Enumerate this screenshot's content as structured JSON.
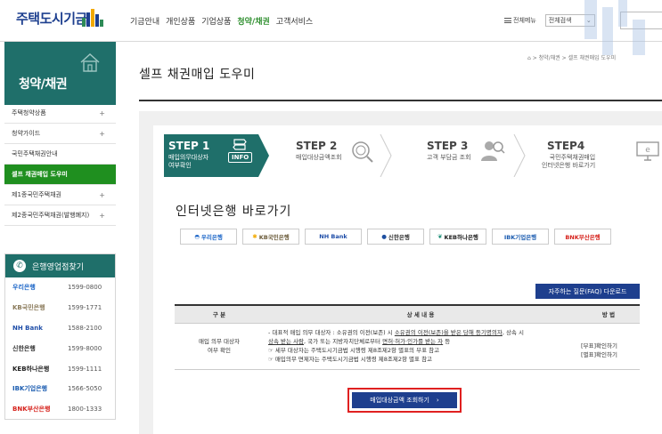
{
  "brand": {
    "name": "주택도시기금"
  },
  "gnb": [
    {
      "label": "기금안내",
      "active": false
    },
    {
      "label": "개인상품",
      "active": false
    },
    {
      "label": "기업상품",
      "active": false
    },
    {
      "label": "청약/채권",
      "active": true
    },
    {
      "label": "고객서비스",
      "active": false
    }
  ],
  "util": {
    "all_menu": "전체메뉴",
    "search_scope": "전체검색"
  },
  "lnb": {
    "title": "청약/채권",
    "items": [
      {
        "label": "주택청약상품",
        "plus": "+"
      },
      {
        "label": "청약가이드",
        "plus": "+"
      },
      {
        "label": "국민주택채권안내",
        "plus": ""
      },
      {
        "label": "셀프 채권매입 도우미",
        "plus": "",
        "active": true
      },
      {
        "label": "제1종국민주택채권",
        "plus": "+"
      },
      {
        "label": "제2종국민주택채권(발행폐지)",
        "plus": "+"
      }
    ]
  },
  "bankbox": {
    "title": "은행영업점찾기",
    "banks": [
      {
        "name": "우리은행",
        "tel": "1599-0800",
        "color": "#1e67c8"
      },
      {
        "name": "KB국민은행",
        "tel": "1599-1771",
        "color": "#f2a900"
      },
      {
        "name": "NH Bank",
        "tel": "1588-2100",
        "color": "#1f4ea8"
      },
      {
        "name": "신한은행",
        "tel": "1599-8000",
        "color": "#1e4fa0"
      },
      {
        "name": "KEB하나은행",
        "tel": "1599-1111",
        "color": "#138a72"
      },
      {
        "name": "IBK기업은행",
        "tel": "1566-5050",
        "color": "#1b5cb0"
      },
      {
        "name": "BNK부산은행",
        "tel": "1800-1333",
        "color": "#d6231d"
      }
    ]
  },
  "page": {
    "title": "셀프 채권매입 도우미",
    "breadcrumb": "⌂ > 청약/채권 > 셀프 채권매입 도우미"
  },
  "steps": [
    {
      "no": "STEP 1",
      "desc": "매입의무대상자\n여부확인",
      "badge": "INFO"
    },
    {
      "no": "STEP 2",
      "desc": "매입대상금액조회"
    },
    {
      "no": "STEP 3",
      "desc": "고객 부담금 조회"
    },
    {
      "no": "STEP4",
      "desc": "국민주택채권매입\n인터넷은행 바로가기"
    }
  ],
  "section": {
    "title": "인터넷은행 바로가기",
    "bank_buttons": [
      "우리은행",
      "KB국민은행",
      "NH Bank",
      "신한은행",
      "KEB하나은행",
      "IBK기업은행",
      "BNK부산은행"
    ],
    "faq_button": "자주하는 질문(FAQ) 다운로드"
  },
  "table": {
    "headers": [
      "구 분",
      "상 세 내 용",
      "방 법"
    ],
    "row": {
      "category_line1": "매입 의무 대상자",
      "category_line2": "여부 확인",
      "detail_1a": "- 대표적 매입 의무 대상자 : 소유권의 이전(보존) 시 ",
      "detail_1b": "소유권의 이전(보존)을 받은 당해 등기명의자",
      "detail_1c": ", 상속 시",
      "detail_2a": "상속 받는 사람",
      "detail_2b": ", 국가 또는 지방자치단체로부터 ",
      "detail_2c": "면허·허가·인가를 받는 자",
      "detail_2d": " 등",
      "detail_3": "☞ 세부 대상자는 주택도시기금법 시행령 제8조제2항 별표의 부표 참고",
      "detail_4": "☞ 매입의무 면제자는 주택도시기금법 시행령 제8조제2항 별표 참고",
      "method_1": "[부표]확인하기",
      "method_2": "[별표]확인하기"
    }
  },
  "cta": {
    "label": "매입대상금액 조회하기",
    "arrow": "›"
  }
}
